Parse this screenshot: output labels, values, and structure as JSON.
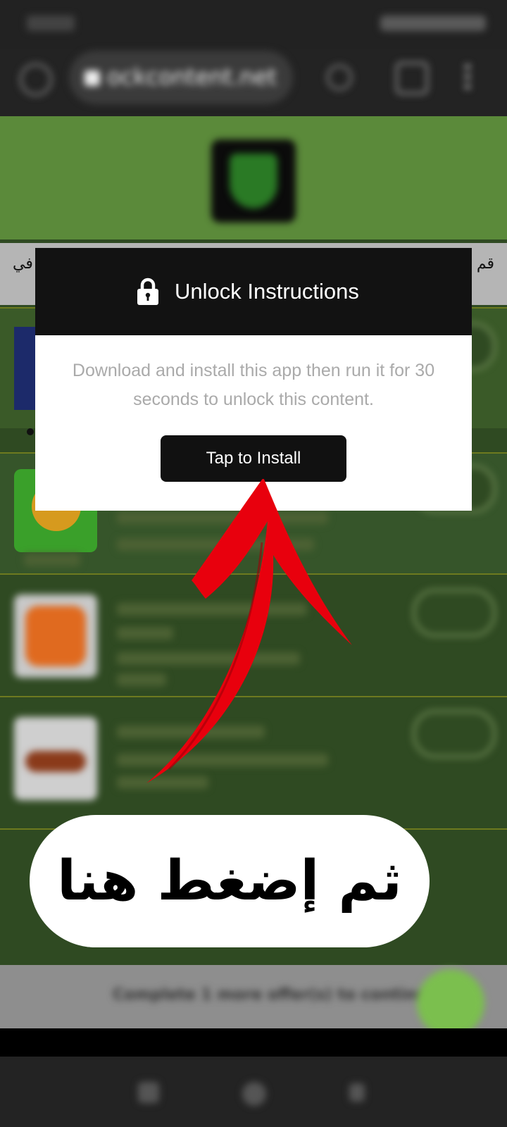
{
  "browser": {
    "url": "ockcontent.net"
  },
  "page": {
    "banner_left": "في",
    "banner_right": "قم"
  },
  "bottom_bar": {
    "text": "Complete 1 more offer(s) to continue"
  },
  "dialog": {
    "title": "Unlock Instructions",
    "message": "Download and install this app then run it for 30 seconds to unlock this content.",
    "button_label": "Tap to Install",
    "icon": "lock-icon"
  },
  "overlay": {
    "callout_text": "ثم إضغط هنا",
    "arrow_color": "#e8000d"
  },
  "colors": {
    "page_green": "#5b8a3a",
    "dialog_header": "#121212",
    "button": "#111111"
  }
}
